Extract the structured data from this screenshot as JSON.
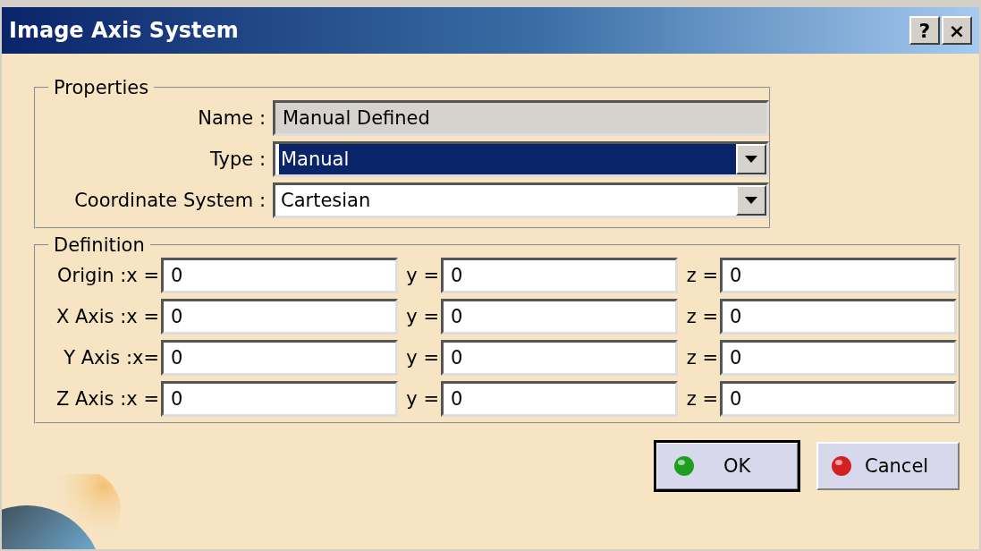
{
  "window": {
    "title": "Image Axis System",
    "title_buttons": [
      "?",
      "×"
    ]
  },
  "properties": {
    "legend": "Properties",
    "fields": [
      {
        "kind": "text",
        "label": "Name :",
        "value": "Manual Defined",
        "disabled": true,
        "focused": false
      },
      {
        "kind": "dropdown",
        "label": "Type :",
        "value": "Manual",
        "disabled": false,
        "focused": true
      },
      {
        "kind": "dropdown",
        "label": "Coordinate System :",
        "value": "Cartesian",
        "disabled": false,
        "focused": false
      }
    ]
  },
  "definition": {
    "legend": "Definition",
    "rows": [
      {
        "cells": [
          {
            "label": "Origin :x =",
            "value": "0"
          },
          {
            "label": "y =",
            "value": "0"
          },
          {
            "label": "z =",
            "value": "0"
          }
        ]
      },
      {
        "cells": [
          {
            "label": "X Axis :x =",
            "value": "0"
          },
          {
            "label": "y =",
            "value": "0"
          },
          {
            "label": "z =",
            "value": "0"
          }
        ]
      },
      {
        "cells": [
          {
            "label": "Y Axis :x=",
            "value": "0"
          },
          {
            "label": "y =",
            "value": "0"
          },
          {
            "label": "z =",
            "value": "0"
          }
        ]
      },
      {
        "cells": [
          {
            "label": "Z Axis :x =",
            "value": "0"
          },
          {
            "label": "y =",
            "value": "0"
          },
          {
            "label": "z =",
            "value": "0"
          }
        ]
      }
    ]
  },
  "buttons": [
    {
      "label": "OK",
      "default": true,
      "color": "#1e9e1e"
    },
    {
      "label": "Cancel",
      "default": false,
      "color": "#d42020"
    }
  ]
}
